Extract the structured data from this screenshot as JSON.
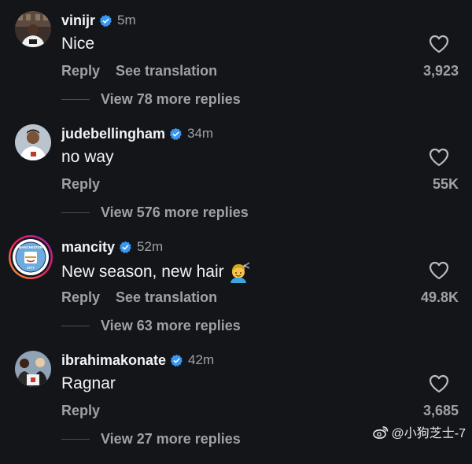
{
  "comments": [
    {
      "username": "vinijr",
      "time": "5m",
      "text": "Nice",
      "reply": "Reply",
      "translation": "See translation",
      "likes": "3,923",
      "view_more": "View 78 more replies"
    },
    {
      "username": "judebellingham",
      "time": "34m",
      "text": "no way",
      "reply": "Reply",
      "likes": "55K",
      "view_more": "View 576 more replies"
    },
    {
      "username": "mancity",
      "time": "52m",
      "text": "New season, new hair",
      "reply": "Reply",
      "translation": "See translation",
      "likes": "49.8K",
      "view_more": "View 63 more replies"
    },
    {
      "username": "ibrahimakonate",
      "time": "42m",
      "text": "Ragnar",
      "reply": "Reply",
      "likes": "3,685",
      "view_more": "View 27 more replies"
    }
  ],
  "avatar_logo_text": {
    "top": "MANCHESTER",
    "bottom": "CITY"
  },
  "watermark": "@小狗芝士-7",
  "colors": {
    "background": "#131519",
    "primary_text": "#f2f3f5",
    "secondary_text": "#9ea2a8",
    "verified_badge": "#3897f0"
  },
  "icons": {
    "verified": "verified-badge-icon",
    "like": "heart-outline-icon",
    "emoji": "haircut-emoji-icon",
    "watermark": "weibo-logo-icon"
  }
}
